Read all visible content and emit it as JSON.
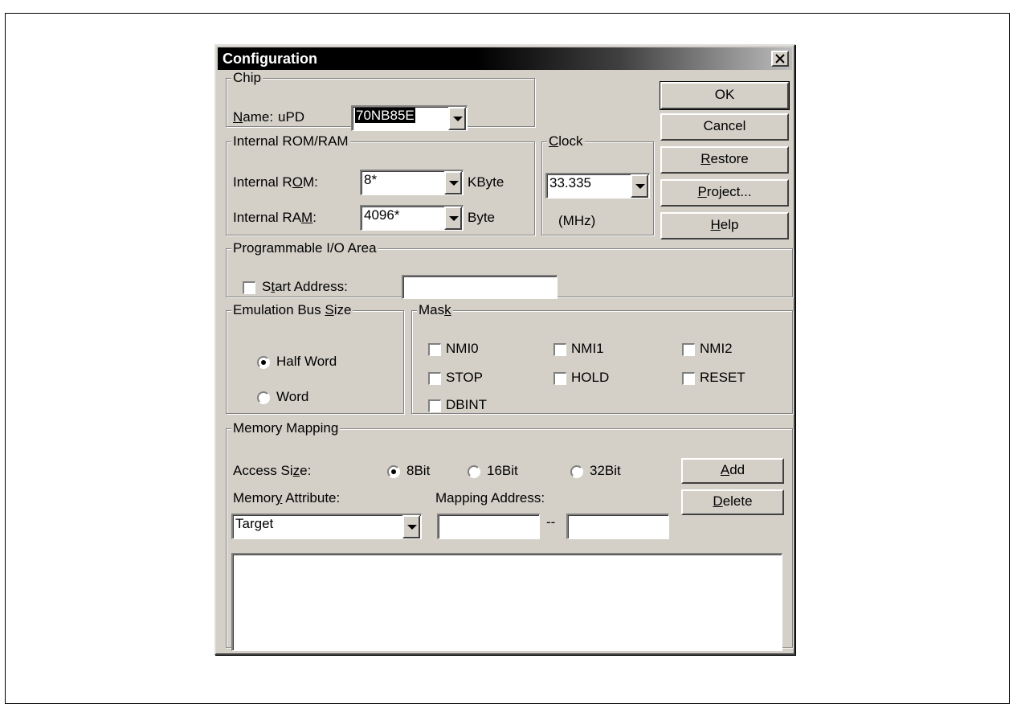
{
  "dialog": {
    "title": "Configuration",
    "close_icon": "close-icon"
  },
  "chip": {
    "legend": "Chip",
    "name_label": "ame:",
    "name_mnemonic": "N",
    "prefix": "uPD",
    "name_value": "70NB85E"
  },
  "internal_mem": {
    "legend": "Internal ROM/RAM",
    "rom_label_pre": "Internal R",
    "rom_label_mn": "O",
    "rom_label_post": "M:",
    "rom_value": "8*",
    "rom_unit": "KByte",
    "ram_label_pre": "Internal RA",
    "ram_label_mn": "M",
    "ram_label_post": ":",
    "ram_value": "4096*",
    "ram_unit": "Byte"
  },
  "clock": {
    "legend_mn": "C",
    "legend_rest": "lock",
    "value": "33.335",
    "unit": "(MHz)"
  },
  "buttons": {
    "ok": "OK",
    "cancel": "Cancel",
    "restore_mn": "R",
    "restore_rest": "estore",
    "project_mn": "P",
    "project_rest": "roject...",
    "help_mn": "H",
    "help_rest": "elp"
  },
  "prog_io": {
    "legend": "Programmable I/O Area",
    "start_pre": "S",
    "start_mn": "t",
    "start_post": "art Address:",
    "start_value": "",
    "start_checked": false
  },
  "bus_size": {
    "legend_pre": "Emulation Bus ",
    "legend_mn": "S",
    "legend_post": "ize",
    "half_word": "Half Word",
    "word": "Word",
    "selected": "Half Word"
  },
  "mask": {
    "legend_pre": "Mas",
    "legend_mn": "k",
    "items": [
      "NMI0",
      "NMI1",
      "NMI2",
      "STOP",
      "HOLD",
      "RESET",
      "DBINT"
    ]
  },
  "memory_mapping": {
    "legend": "Memory Mapping",
    "access_pre": "Access Si",
    "access_mn": "z",
    "access_post": "e:",
    "opt_8": "8Bit",
    "opt_16": "16Bit",
    "opt_32": "32Bit",
    "selected": "8Bit",
    "attr_pre": "Memor",
    "attr_mn": "y",
    "attr_post": " Attribute:",
    "attr_value": "Target",
    "map_pre": "Mappin",
    "map_mn": "g",
    "map_post": " Address:",
    "map_from": "",
    "map_to": "",
    "separator": "--",
    "add_mn": "A",
    "add_rest": "dd",
    "delete_mn": "D",
    "delete_rest": "elete"
  }
}
